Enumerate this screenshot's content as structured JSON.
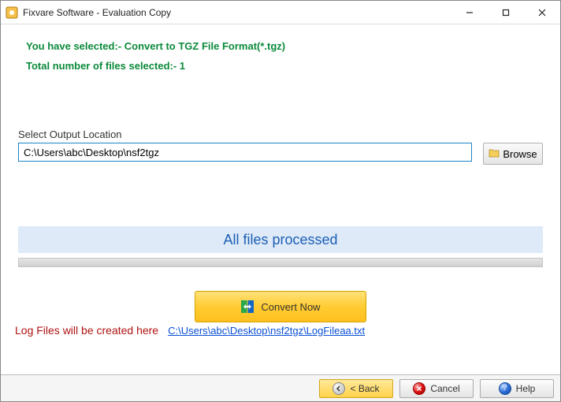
{
  "titlebar": {
    "title": "Fixvare Software - Evaluation Copy"
  },
  "info": {
    "selected_format": "You have selected:- Convert to TGZ File Format(*.tgz)",
    "file_count": "Total number of files selected:- 1"
  },
  "output": {
    "label": "Select Output Location",
    "path": "C:\\Users\\abc\\Desktop\\nsf2tgz",
    "browse_label": "Browse"
  },
  "status": {
    "message": "All files processed"
  },
  "actions": {
    "convert_label": "Convert Now"
  },
  "log": {
    "label": "Log Files will be created here",
    "path": "C:\\Users\\abc\\Desktop\\nsf2tgz\\LogFileaa.txt"
  },
  "buttons": {
    "back": "< Back",
    "cancel": "Cancel",
    "help": "Help"
  }
}
